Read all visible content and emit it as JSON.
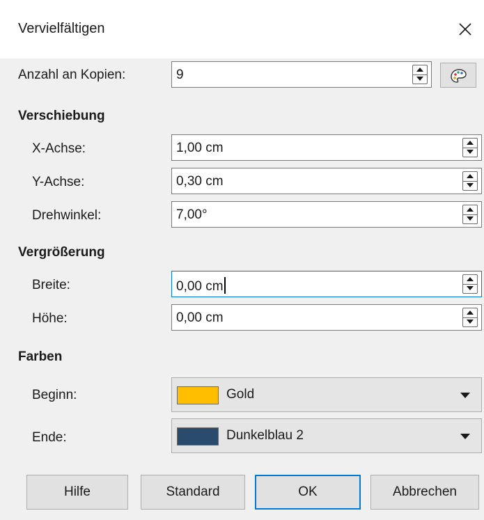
{
  "window": {
    "title": "Vervielfältigen",
    "close_icon": "close-icon"
  },
  "copies": {
    "label": "Anzahl an Kopien:",
    "value": "9",
    "palette_icon": "color-palette-icon"
  },
  "displacement": {
    "heading": "Verschiebung",
    "x_label": "X-Achse:",
    "x_value": "1,00 cm",
    "y_label": "Y-Achse:",
    "y_value": "0,30 cm",
    "angle_label": "Drehwinkel:",
    "angle_value": "7,00°"
  },
  "enlargement": {
    "heading": "Vergrößerung",
    "width_label": "Breite:",
    "width_value": "0,00 cm",
    "height_label": "Höhe:",
    "height_value": "0,00 cm"
  },
  "colors": {
    "heading": "Farben",
    "start_label": "Beginn:",
    "start_name": "Gold",
    "start_color": "#ffbf00",
    "end_label": "Ende:",
    "end_name": "Dunkelblau 2",
    "end_color": "#2a4b6b"
  },
  "buttons": {
    "help": "Hilfe",
    "default": "Standard",
    "ok": "OK",
    "cancel": "Abbrechen"
  }
}
